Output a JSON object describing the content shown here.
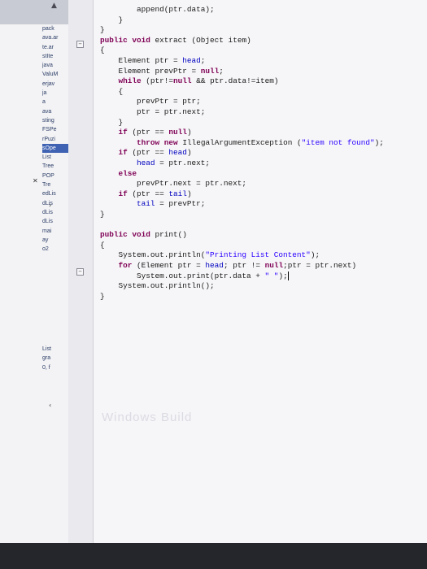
{
  "sidebar": {
    "items": [
      "pack",
      "ava.ar",
      "te.ar",
      "stIte",
      "java",
      "ValuM",
      "erjav",
      "ja",
      "a",
      "ava",
      "sting",
      "FSPe",
      "rPuzi",
      "sOpe",
      "List",
      "Tree",
      "POP",
      "Tre",
      "edLis",
      "dLis",
      "dLis",
      "dLis",
      "mai",
      "ay",
      "o2"
    ],
    "selected_index": 13,
    "bottom_items": [
      "List",
      "gra",
      "0, f"
    ]
  },
  "editor": {
    "lines": [
      "        append(ptr.data);",
      "    }",
      "}",
      "public void extract (Object item)",
      "{",
      "    Element ptr = head;",
      "    Element prevPtr = null;",
      "    while (ptr!=null && ptr.data!=item)",
      "    {",
      "        prevPtr = ptr;",
      "        ptr = ptr.next;",
      "    }",
      "    if (ptr == null)",
      "        throw new IllegalArgumentException (\"item not found\");",
      "    if (ptr == head)",
      "        head = ptr.next;",
      "    else",
      "        prevPtr.next = ptr.next;",
      "    if (ptr == tail)",
      "        tail = prevPtr;",
      "}",
      "",
      "public void print()",
      "{",
      "    System.out.println(\"Printing List Content\");",
      "    for (Element ptr = head; ptr != null;ptr = ptr.next)",
      "        System.out.print(ptr.data + \" \");",
      "    System.out.println();",
      "}"
    ],
    "watermark": "Windows Build"
  },
  "icons": {
    "scroll_up": "up-arrow-icon",
    "close": "close-icon",
    "collapse": "chevron-icon"
  }
}
